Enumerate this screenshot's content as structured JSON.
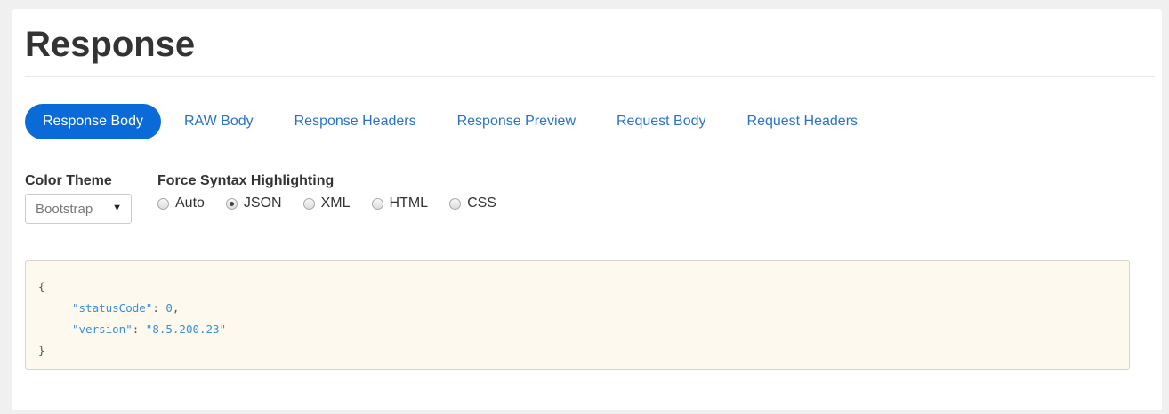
{
  "title": "Response",
  "tabs": [
    {
      "label": "Response Body",
      "active": true
    },
    {
      "label": "RAW Body",
      "active": false
    },
    {
      "label": "Response Headers",
      "active": false
    },
    {
      "label": "Response Preview",
      "active": false
    },
    {
      "label": "Request Body",
      "active": false
    },
    {
      "label": "Request Headers",
      "active": false
    }
  ],
  "color_theme": {
    "label": "Color Theme",
    "selected": "Bootstrap"
  },
  "syntax": {
    "label": "Force Syntax Highlighting",
    "options": [
      {
        "label": "Auto",
        "checked": false
      },
      {
        "label": "JSON",
        "checked": true
      },
      {
        "label": "XML",
        "checked": false
      },
      {
        "label": "HTML",
        "checked": false
      },
      {
        "label": "CSS",
        "checked": false
      }
    ]
  },
  "code": {
    "open_brace": "{",
    "close_brace": "}",
    "lines": [
      {
        "key": "\"statusCode\"",
        "sep": ": ",
        "value": "0",
        "trail": ","
      },
      {
        "key": "\"version\"",
        "sep": ": ",
        "value": "\"8.5.200.23\"",
        "trail": ""
      }
    ]
  },
  "colors": {
    "accent": "#0a6ad8",
    "link": "#2a72c9",
    "code_bg": "#fdf9ef",
    "code_key": "#3b8fd6"
  }
}
